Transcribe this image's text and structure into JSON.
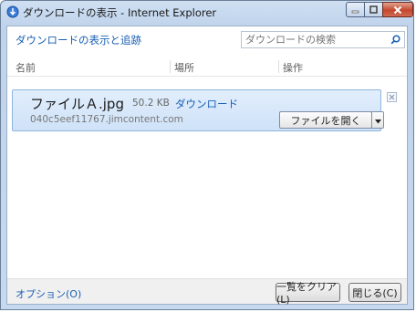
{
  "window": {
    "title": "ダウンロードの表示 - Internet Explorer",
    "app_icon": "ie-download-icon"
  },
  "header": {
    "view_track_link": "ダウンロードの表示と追跡",
    "search_placeholder": "ダウンロードの検索"
  },
  "columns": {
    "name": "名前",
    "location": "場所",
    "actions": "操作"
  },
  "downloads": [
    {
      "filename": "ファイルＡ.jpg",
      "size": "50.2 KB",
      "location": "ダウンロード",
      "source": "040c5eef11767.jimcontent.com",
      "action_label": "ファイルを開く"
    }
  ],
  "footer": {
    "options_label": "オプション(O)",
    "clear_label": "一覧をクリア(L)",
    "close_label": "閉じる(C)"
  },
  "colors": {
    "link": "#1a5fb4",
    "item_highlight": "#cfe2f8",
    "close_button": "#c4472d"
  }
}
